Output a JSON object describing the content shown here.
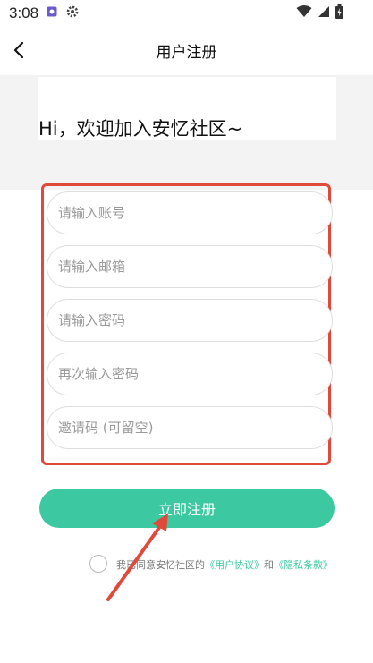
{
  "status_bar": {
    "time": "3:08"
  },
  "nav": {
    "title": "用户注册"
  },
  "hero": {
    "title": "Hi，欢迎加入安忆社区~"
  },
  "form": {
    "account_placeholder": "请输入账号",
    "email_placeholder": "请输入邮箱",
    "password_placeholder": "请输入密码",
    "confirm_placeholder": "再次输入密码",
    "invite_placeholder": "邀请码 (可留空)"
  },
  "submit": {
    "label": "立即注册"
  },
  "agreement": {
    "prefix": "我已同意安忆社区的",
    "user_agreement": "《用户协议》",
    "and": "和",
    "privacy": "《隐私条款》"
  },
  "colors": {
    "accent": "#3cc9a2",
    "annotation": "#e04a3a"
  }
}
